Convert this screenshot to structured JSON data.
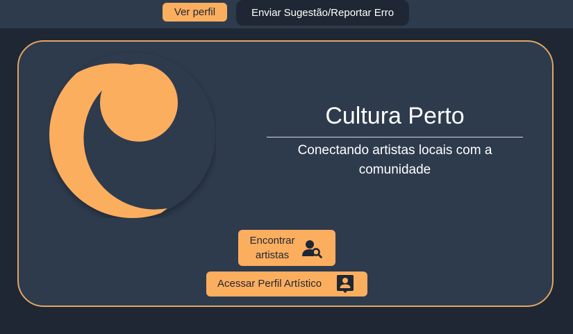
{
  "topbar": {
    "ver_perfil_label": "Ver perfil",
    "sugestao_label": "Enviar Sugestão/Reportar Erro"
  },
  "hero": {
    "title": "Cultura Perto",
    "subtitle": "Conectando artistas locais com a comunidade",
    "logo_icon": "crescent-moon-logo"
  },
  "actions": {
    "encontrar_label": "Encontrar artistas",
    "encontrar_icon": "user-search-icon",
    "acessar_label": "Acessar Perfil Artístico",
    "acessar_icon": "artist-profile-icon"
  },
  "colors": {
    "accent": "#fcae5f",
    "background": "#1e2733",
    "panel": "#2d3b4d",
    "card_border": "#e3a565",
    "text": "#ffffff"
  }
}
